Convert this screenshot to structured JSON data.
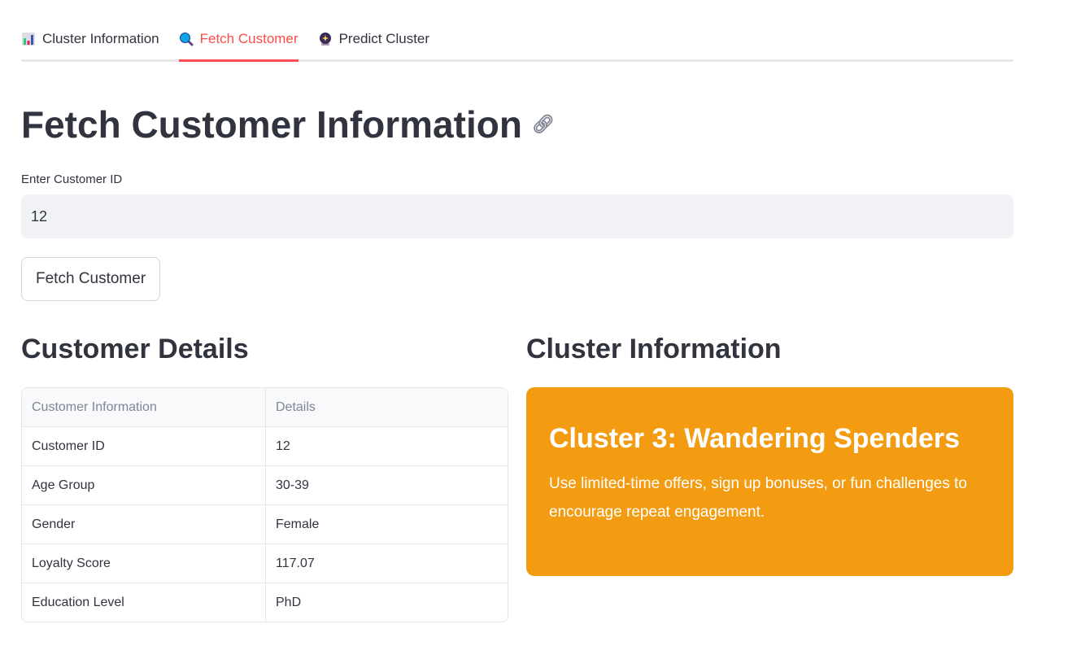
{
  "tabs": [
    {
      "label": "Cluster Information",
      "icon": "bar-chart-icon",
      "active": false
    },
    {
      "label": "Fetch Customer",
      "icon": "magnifier-icon",
      "active": true
    },
    {
      "label": "Predict Cluster",
      "icon": "crystal-ball-icon",
      "active": false
    }
  ],
  "colors": {
    "accent": "#ff4b4b",
    "card": "#f39c12"
  },
  "page_title": "Fetch Customer Information",
  "input": {
    "label": "Enter Customer ID",
    "value": "12"
  },
  "fetch_button": "Fetch Customer",
  "details": {
    "title": "Customer Details",
    "columns": [
      "Customer Information",
      "Details"
    ],
    "rows": [
      [
        "Customer ID",
        "12"
      ],
      [
        "Age Group",
        "30-39"
      ],
      [
        "Gender",
        "Female"
      ],
      [
        "Loyalty Score",
        "117.07"
      ],
      [
        "Education Level",
        "PhD"
      ]
    ]
  },
  "cluster": {
    "title": "Cluster Information",
    "name": "Cluster 3: Wandering Spenders",
    "description": "Use limited-time offers, sign up bonuses, or fun challenges to encourage repeat engagement."
  }
}
